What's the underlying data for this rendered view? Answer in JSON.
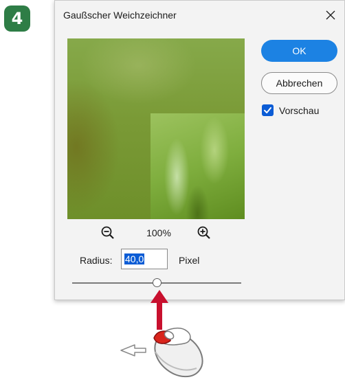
{
  "step": {
    "number": "4"
  },
  "dialog": {
    "title": "Gaußscher Weichzeichner",
    "close_icon": "close-icon",
    "zoom": {
      "out_icon": "zoom-out-icon",
      "level": "100%",
      "in_icon": "zoom-in-icon"
    },
    "radius": {
      "label": "Radius:",
      "value": "40,0",
      "unit": "Pixel",
      "slider_fraction": 0.5
    },
    "buttons": {
      "ok": "OK",
      "cancel": "Abbrechen"
    },
    "preview": {
      "label": "Vorschau",
      "checked": true
    }
  },
  "illustration": {
    "pointer": "red-up-arrow",
    "mouse": "mouse-left-click-drag-left",
    "colors": {
      "arrow": "#c8102e",
      "mouse_button": "#d9251c",
      "check_accent": "#0b5cd5",
      "ok_button": "#1c82e3"
    }
  }
}
